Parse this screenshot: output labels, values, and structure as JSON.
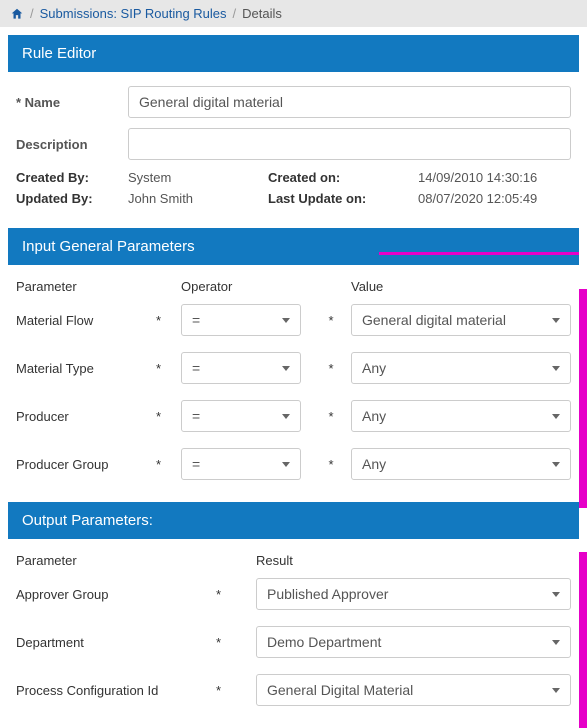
{
  "breadcrumb": {
    "main": "Submissions: SIP Routing Rules",
    "current": "Details"
  },
  "ruleEditor": {
    "title": "Rule Editor",
    "nameLabel": "* Name",
    "nameValue": "General digital material",
    "descriptionLabel": "Description",
    "descriptionValue": "",
    "createdByLabel": "Created By:",
    "createdByValue": "System",
    "createdOnLabel": "Created on:",
    "createdOnValue": "14/09/2010 14:30:16",
    "updatedByLabel": "Updated By:",
    "updatedByValue": "John Smith",
    "lastUpdateLabel": "Last Update on:",
    "lastUpdateValue": "08/07/2020 12:05:49"
  },
  "inputParams": {
    "title": "Input General Parameters",
    "headers": {
      "parameter": "Parameter",
      "operator": "Operator",
      "value": "Value"
    },
    "rows": [
      {
        "label": "Material Flow",
        "operator": "=",
        "value": "General digital material"
      },
      {
        "label": "Material Type",
        "operator": "=",
        "value": "Any"
      },
      {
        "label": "Producer",
        "operator": "=",
        "value": "Any"
      },
      {
        "label": "Producer Group",
        "operator": "=",
        "value": "Any"
      }
    ]
  },
  "outputParams": {
    "title": "Output Parameters:",
    "headers": {
      "parameter": "Parameter",
      "result": "Result"
    },
    "rows": [
      {
        "label": "Approver Group",
        "value": "Published Approver"
      },
      {
        "label": "Department",
        "value": "Demo Department"
      },
      {
        "label": "Process Configuration Id",
        "value": "General Digital Material"
      }
    ]
  },
  "asterisk": "*"
}
